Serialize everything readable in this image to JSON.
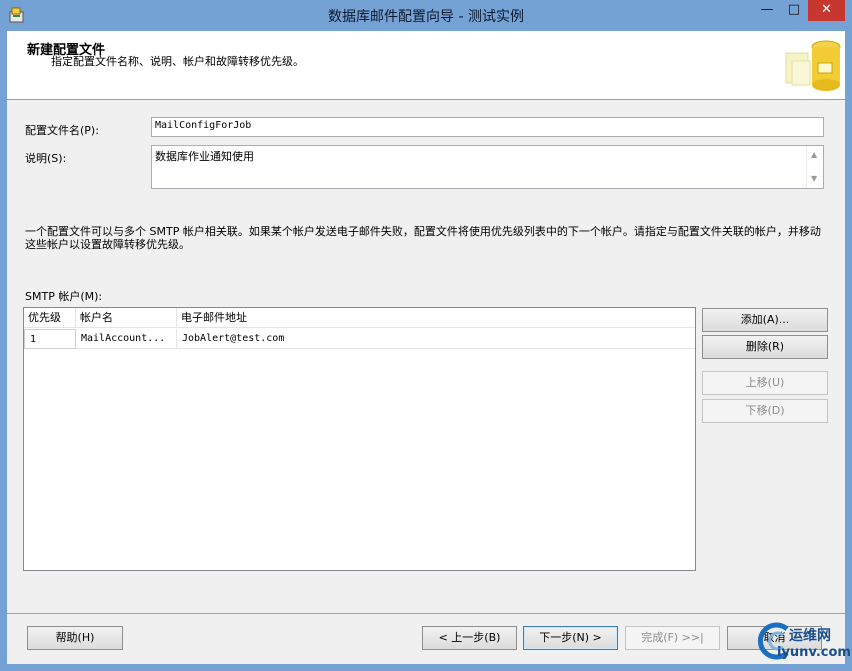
{
  "window": {
    "title": "数据库邮件配置向导 - 测试实例",
    "min_glyph": "—",
    "max_glyph": "□",
    "close_glyph": "✕"
  },
  "header": {
    "title": "新建配置文件",
    "subtitle": "指定配置文件名称、说明、帐户和故障转移优先级。"
  },
  "form": {
    "profile_name_label": "配置文件名(P):",
    "profile_name_value": "MailConfigForJob",
    "description_label": "说明(S):",
    "description_value": "数据库作业通知使用",
    "info_text": "一个配置文件可以与多个 SMTP 帐户相关联。如果某个帐户发送电子邮件失败，配置文件将使用优先级列表中的下一个帐户。请指定与配置文件关联的帐户，并移动这些帐户以设置故障转移优先级。"
  },
  "smtp": {
    "label": "SMTP 帐户(M):",
    "columns": [
      "优先级",
      "帐户名",
      "电子邮件地址"
    ],
    "rows": [
      {
        "priority": "1",
        "account": "MailAccount...",
        "email": "JobAlert@test.com"
      }
    ]
  },
  "side_buttons": {
    "add": "添加(A)...",
    "remove": "删除(R)",
    "move_up": "上移(U)",
    "move_down": "下移(D)"
  },
  "footer": {
    "help": "帮助(H)",
    "back": "< 上一步(B)",
    "next": "下一步(N) >",
    "finish": "完成(F) >>|",
    "cancel": "取消"
  },
  "watermark": {
    "text_cn": "运维网",
    "text_en": "iyunv.com"
  },
  "colors": {
    "titlebar": "#74a2d4",
    "close_button": "#c7372f",
    "dialog_bg": "#f0f0f0"
  }
}
